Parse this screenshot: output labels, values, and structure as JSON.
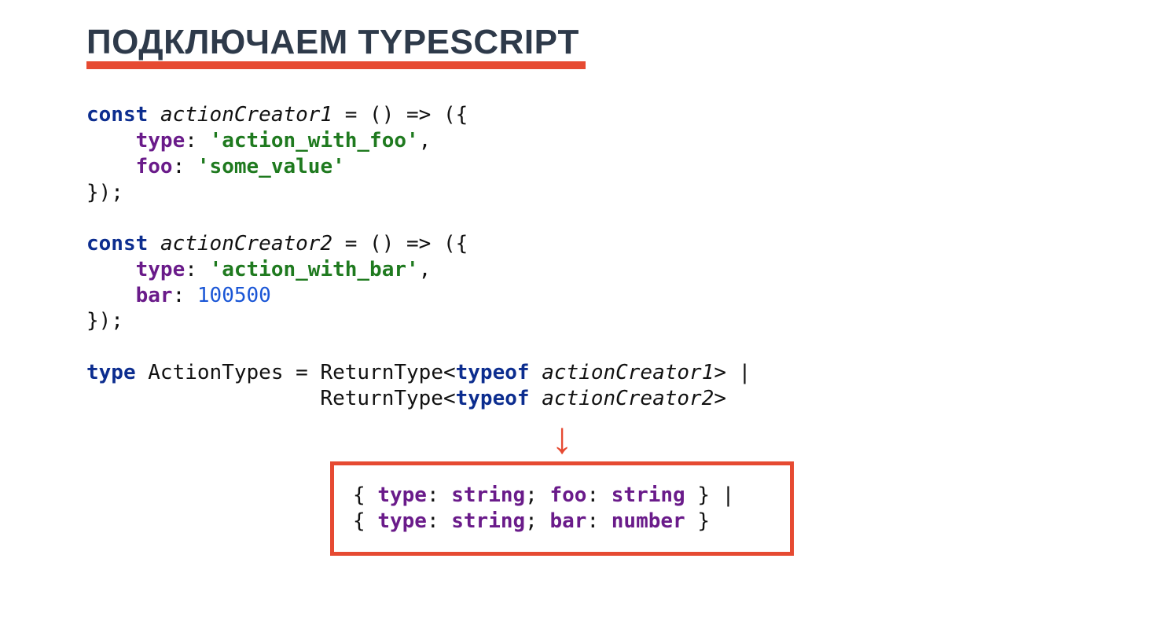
{
  "title": "ПОДКЛЮЧАЕМ TYPESCRIPT",
  "code": {
    "ac1": {
      "kw_const": "const",
      "name": "actionCreator1",
      "arrow": " = () => ({",
      "p_type": "type",
      "v_type": "'action_with_foo'",
      "p_foo": "foo",
      "v_foo": "'some_value'",
      "close": "});"
    },
    "ac2": {
      "kw_const": "const",
      "name": "actionCreator2",
      "arrow": " = () => ({",
      "p_type": "type",
      "v_type": "'action_with_bar'",
      "p_bar": "bar",
      "v_bar": "100500",
      "close": "});"
    },
    "typedecl": {
      "kw_type": "type",
      "name": "ActionTypes",
      "eq": " = ",
      "rt": "ReturnType<",
      "kw_typeof": "typeof",
      "ac1": "actionCreator1",
      "ac2": "actionCreator2",
      "gt_pipe": "> |",
      "gt": ">"
    }
  },
  "arrow_glyph": "↓",
  "result": {
    "l1_open": "{ ",
    "p_type": "type",
    "kw_string": "string",
    "p_foo": "foo",
    "l1_close": " } |",
    "p_bar": "bar",
    "kw_number": "number",
    "l2_close": " }"
  }
}
